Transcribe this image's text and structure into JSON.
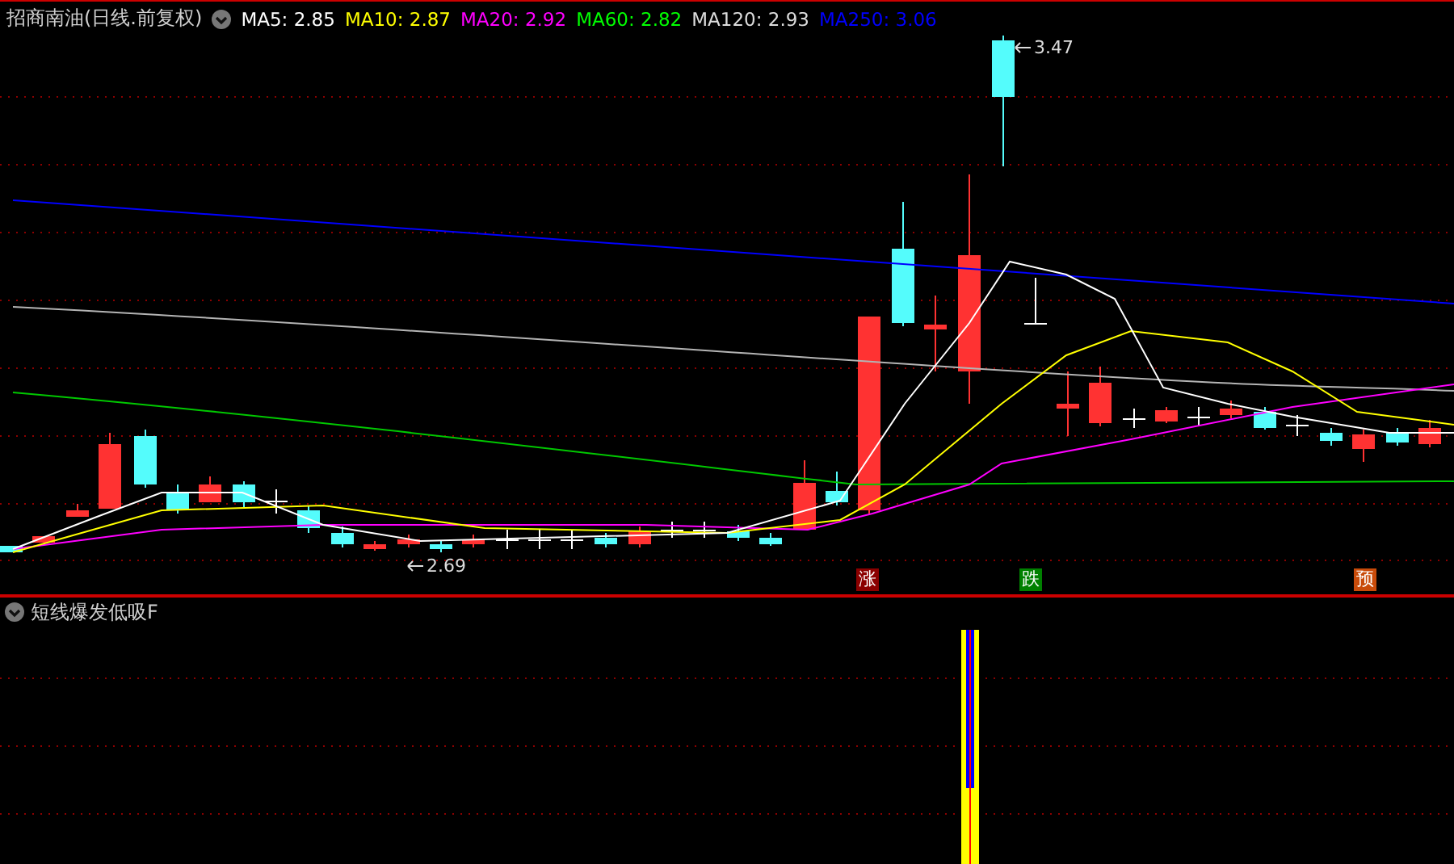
{
  "chart_header": {
    "title": "招商南油(日线.前复权)",
    "ma_lines": [
      {
        "label": "MA5: 2.85",
        "color": "#ffffff"
      },
      {
        "label": "MA10: 2.87",
        "color": "#ffff00"
      },
      {
        "label": "MA20: 2.92",
        "color": "#ff00ff"
      },
      {
        "label": "MA60: 2.82",
        "color": "#00ff00"
      },
      {
        "label": "MA120: 2.93",
        "color": "#dcdcdc"
      },
      {
        "label": "MA250: 3.06",
        "color": "#0000ff"
      }
    ]
  },
  "price_labels": [
    "3.47",
    "2.69"
  ],
  "signals": [
    {
      "text": "涨",
      "color": "#8b0000"
    },
    {
      "text": "跌",
      "color": "#008000"
    },
    {
      "text": "预",
      "color": "#c84b0a"
    }
  ],
  "indicator_panel": {
    "title": "短线爆发低吸F"
  }
}
